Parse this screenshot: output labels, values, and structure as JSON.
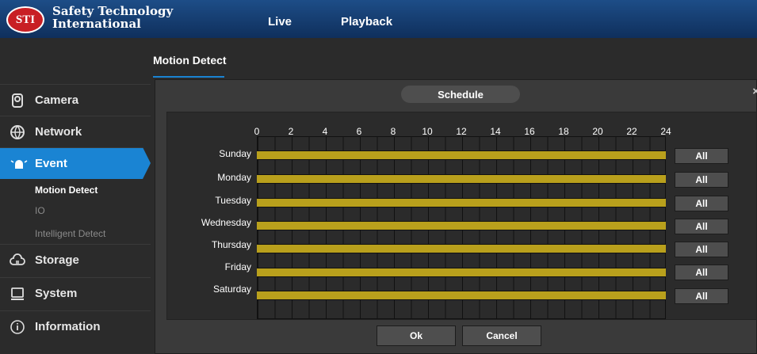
{
  "header": {
    "logo_badge": "STI",
    "logo_line1": "Safety Technology",
    "logo_line2": "International",
    "tabs": [
      {
        "label": "Live"
      },
      {
        "label": "Playback"
      }
    ]
  },
  "sidebar": {
    "items": [
      {
        "label": "Camera",
        "icon": "camera-icon"
      },
      {
        "label": "Network",
        "icon": "globe-icon"
      },
      {
        "label": "Event",
        "icon": "alarm-icon",
        "active": true
      },
      {
        "label": "Storage",
        "icon": "cloud-icon"
      },
      {
        "label": "System",
        "icon": "monitor-icon"
      },
      {
        "label": "Information",
        "icon": "info-icon"
      }
    ],
    "event_subitems": [
      {
        "label": "Motion Detect",
        "active": true
      },
      {
        "label": "IO"
      },
      {
        "label": "Intelligent Detect"
      }
    ]
  },
  "content": {
    "title": "Motion Detect"
  },
  "modal": {
    "title": "Schedule",
    "close": "×",
    "hours": [
      "0",
      "2",
      "4",
      "6",
      "8",
      "10",
      "12",
      "14",
      "16",
      "18",
      "20",
      "22",
      "24"
    ],
    "days": [
      "Sunday",
      "Monday",
      "Tuesday",
      "Wednesday",
      "Thursday",
      "Friday",
      "Saturday"
    ],
    "all_label": "All",
    "ok_label": "Ok",
    "cancel_label": "Cancel"
  },
  "colors": {
    "accent": "#1a84d3",
    "schedule_fill": "#b9a01c",
    "header_bg": "#163e70"
  }
}
